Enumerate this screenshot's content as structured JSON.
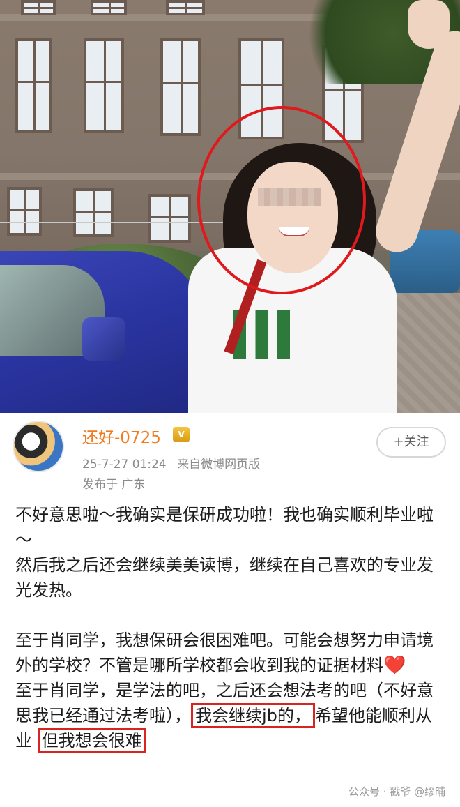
{
  "post": {
    "username": "还好-0725",
    "vip_badge": "V",
    "date": "25-7-27 01:24",
    "source": "来自微博网页版",
    "location": "发布于 广东",
    "follow_label": "+关注",
    "paragraphs": [
      "不好意思啦～我确实是保研成功啦！我也确实顺利毕业啦～",
      "然后我之后还会继续美美读博，继续在自己喜欢的专业发光发热。"
    ],
    "para3": "至于肖同学，我想保研会很困难吧。可能会想努力申请境外的学校？不管是哪所学校都会收到我的证据材料",
    "heart": "❤️",
    "para4_start": "至于肖同学，是学法的吧，之后还会想法考的吧（不好意思我已经通过法考啦），",
    "para4_boxed1": "我会继续jb的，",
    "para4_mid": "希望他能顺利从业 ",
    "para4_boxed2": "但我想会很难"
  },
  "watermark": "公众号 · 戳爷 @缪晡",
  "colors": {
    "username": "#f07a1e",
    "highlight_red": "#e0191c",
    "meta_gray": "#8a8a8a"
  }
}
